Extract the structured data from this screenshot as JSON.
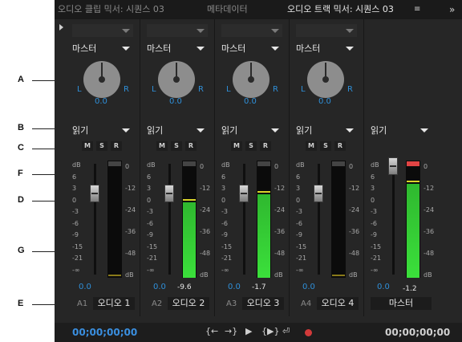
{
  "callouts": [
    "A",
    "B",
    "C",
    "D",
    "E",
    "F",
    "G"
  ],
  "tabs": [
    {
      "label": "오디오 클립 믹서: 시퀀스 03",
      "active": false
    },
    {
      "label": "메타데이터",
      "active": false
    },
    {
      "label": "오디오 트랙 믹서: 시퀀스 03",
      "active": true
    }
  ],
  "tab_menu_icon": "≡",
  "tab_overflow_icon": "»",
  "strips": [
    {
      "output": "마스터",
      "pan": "0.0",
      "automation": "읽기",
      "volume": "0.0",
      "peak": "",
      "num": "A1",
      "name": "오디오 1",
      "meter_level": 0.0
    },
    {
      "output": "마스터",
      "pan": "0.0",
      "automation": "읽기",
      "volume": "0.0",
      "peak": "-9.6",
      "num": "A2",
      "name": "오디오 2",
      "meter_level": 0.72
    },
    {
      "output": "마스터",
      "pan": "0.0",
      "automation": "읽기",
      "volume": "0.0",
      "peak": "-1.7",
      "num": "A3",
      "name": "오디오 3",
      "meter_level": 0.8
    },
    {
      "output": "마스터",
      "pan": "0.0",
      "automation": "읽기",
      "volume": "0.0",
      "peak": "",
      "num": "A4",
      "name": "오디오 4",
      "meter_level": 0.0
    }
  ],
  "master": {
    "automation": "읽기",
    "volume": "0.0",
    "peak": "-1.2",
    "name": "마스터",
    "meter_level": 0.9
  },
  "msr": {
    "m": "M",
    "s": "S",
    "r": "R"
  },
  "pan_l": "L",
  "pan_r": "R",
  "fader_scale": [
    "dB",
    "6",
    "3",
    "0",
    "-3",
    "-6",
    "-9",
    "-15",
    "-21",
    "-∞"
  ],
  "meter_scale": [
    "0",
    "-12",
    "-24",
    "-36",
    "-48",
    "dB"
  ],
  "transport": {
    "timecode_left": "00;00;00;00",
    "timecode_right": "00;00;00;00",
    "buttons": [
      "{←",
      "→}",
      "▶",
      "{▶}",
      "⏎",
      "●"
    ]
  },
  "colors": {
    "accent": "#2f8fd8",
    "meter_green": "#3be03b",
    "clip_red": "#e14444",
    "record": "#d23a3a"
  }
}
